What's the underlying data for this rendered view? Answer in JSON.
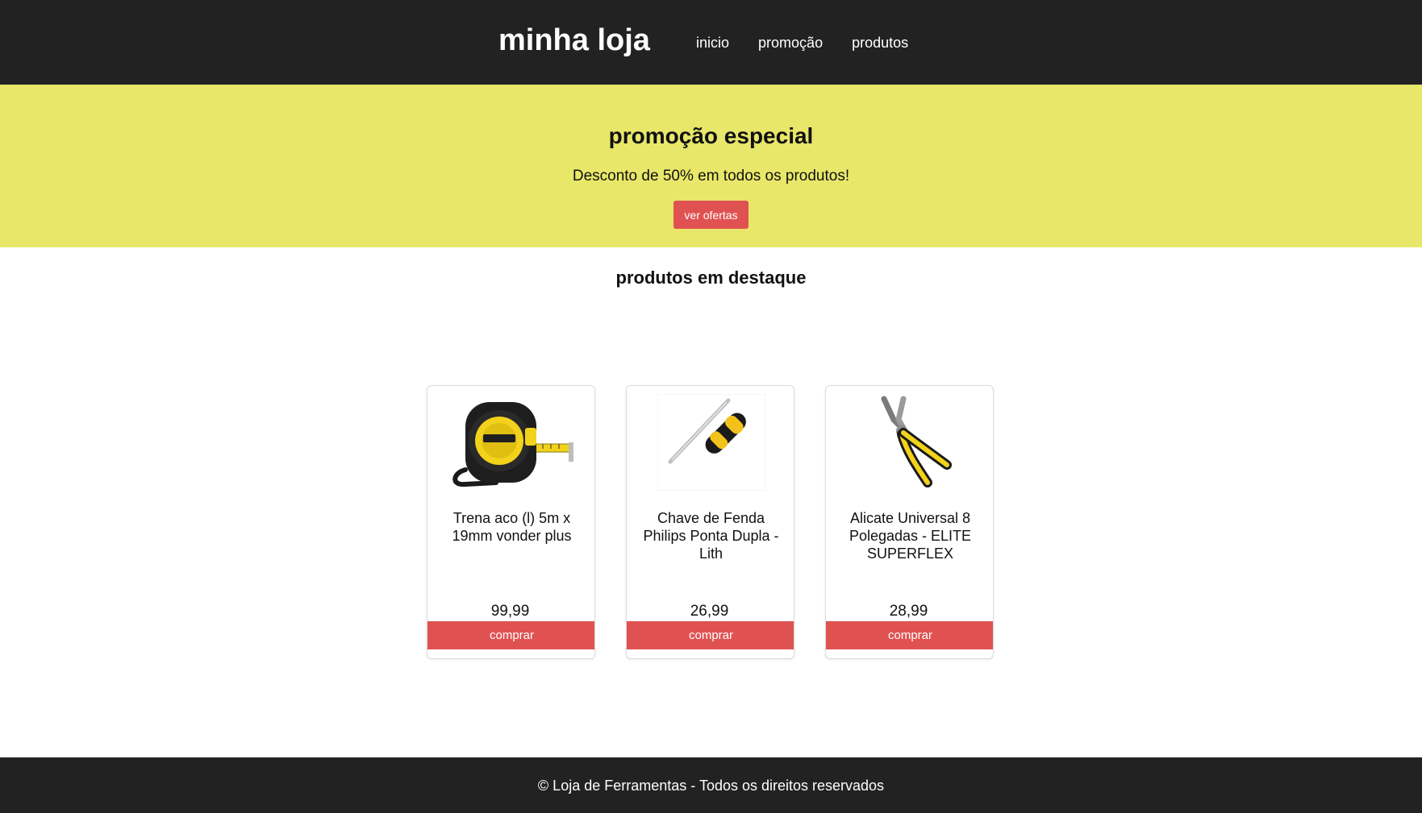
{
  "header": {
    "brand": "minha loja",
    "nav": [
      {
        "label": "inicio"
      },
      {
        "label": "promoção"
      },
      {
        "label": "produtos"
      }
    ]
  },
  "promo": {
    "title": "promoção especial",
    "text": "Desconto de 50% em todos os produtos!",
    "button_label": "ver ofertas"
  },
  "featured": {
    "title": "produtos em destaque",
    "products": [
      {
        "name": "Trena aco (l) 5m x 19mm vonder plus",
        "price": "99,99",
        "buy_label": "comprar",
        "icon": "tape-measure-icon"
      },
      {
        "name": "Chave de Fenda Philips Ponta Dupla - Lith",
        "price": "26,99",
        "buy_label": "comprar",
        "icon": "screwdriver-icon"
      },
      {
        "name": "Alicate Universal 8 Polegadas - ELITE SUPERFLEX",
        "price": "28,99",
        "buy_label": "comprar",
        "icon": "pliers-icon"
      }
    ]
  },
  "footer": {
    "text": "© Loja de Ferramentas - Todos os direitos reservados"
  },
  "colors": {
    "header_bg": "#222222",
    "promo_bg": "#e8e76a",
    "accent_red": "#e05252",
    "product_yellow": "#f2d21b"
  }
}
